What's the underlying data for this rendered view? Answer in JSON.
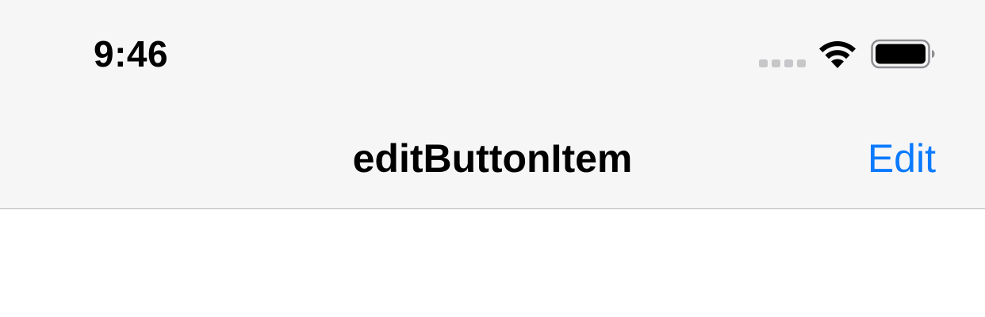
{
  "status_bar": {
    "time": "9:46",
    "icons": [
      "cellular-signal-icon",
      "wifi-icon",
      "battery-icon"
    ]
  },
  "nav_bar": {
    "title": "editButtonItem",
    "edit_label": "Edit"
  },
  "colors": {
    "bar_background": "#f6f6f7",
    "accent": "#0a7aff",
    "divider": "#b8b8bc",
    "content_background": "#ffffff"
  }
}
